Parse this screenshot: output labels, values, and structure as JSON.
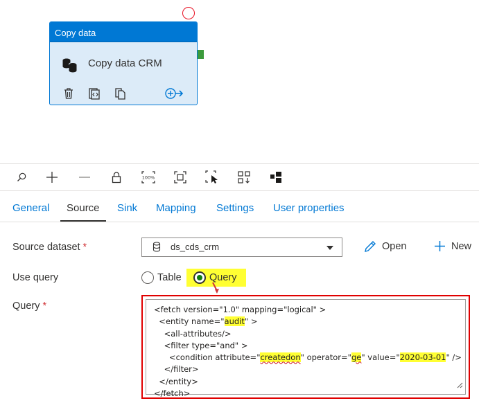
{
  "activity": {
    "type_label": "Copy data",
    "name": "Copy data CRM"
  },
  "tabs": [
    {
      "label": "General"
    },
    {
      "label": "Source"
    },
    {
      "label": "Sink"
    },
    {
      "label": "Mapping"
    },
    {
      "label": "Settings"
    },
    {
      "label": "User properties"
    }
  ],
  "active_tab": "Source",
  "source_dataset": {
    "label": "Source dataset",
    "required_mark": "*",
    "value": "ds_cds_crm",
    "open_label": "Open",
    "new_label": "New"
  },
  "use_query": {
    "label": "Use query",
    "options": [
      "Table",
      "Query"
    ],
    "selected": "Query"
  },
  "query": {
    "label": "Query",
    "required_mark": "*",
    "lines": [
      [
        {
          "t": "<fetch version=\"1.0\" mapping=\"logical\" >"
        }
      ],
      [
        {
          "t": "  <entity name=\""
        },
        {
          "t": "audit",
          "hl": true
        },
        {
          "t": "\" >"
        }
      ],
      [
        {
          "t": "    <all-attributes/>"
        }
      ],
      [
        {
          "t": "    <filter type=\"and\" >"
        }
      ],
      [
        {
          "t": "      <condition attribute=\""
        },
        {
          "t": "createdon",
          "hl": true,
          "sq": true
        },
        {
          "t": "\" operator=\""
        },
        {
          "t": "ge",
          "hl": true,
          "sq": true
        },
        {
          "t": "\" value=\""
        },
        {
          "t": "2020-03-01",
          "hl": true
        },
        {
          "t": "\" />"
        }
      ],
      [
        {
          "t": "    </filter>"
        }
      ],
      [
        {
          "t": "  </entity>"
        }
      ],
      [
        {
          "t": "</fetch>"
        }
      ]
    ]
  },
  "toolbar_icons": [
    "search-icon",
    "zoom-in-icon",
    "zoom-out-icon",
    "lock-icon",
    "zoom-100-icon",
    "fit-to-window-icon",
    "select-icon",
    "auto-align-icon",
    "layout-icon"
  ],
  "colors": {
    "accent": "#0078d4",
    "highlight": "#ffff33",
    "annotation_red": "#e00000",
    "success": "#3c9b3c"
  }
}
